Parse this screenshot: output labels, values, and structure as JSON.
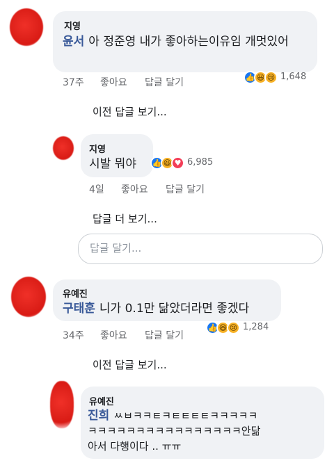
{
  "comments": [
    {
      "author": "지영",
      "tag": "윤서",
      "text": "아 정준영 내가 좋아하는이유임 개멋있어",
      "time": "37주",
      "like_label": "좋아요",
      "reply_label": "답글 달기",
      "reaction_count": "1,648",
      "reactions": [
        "like-icon",
        "haha-icon",
        "sad-icon"
      ]
    },
    {
      "author": "지영",
      "text": "시발 뭐야",
      "time": "4일",
      "like_label": "좋아요",
      "reply_label": "답글 달기",
      "reaction_count": "6,985",
      "reactions": [
        "like-icon",
        "haha-icon",
        "love-icon"
      ]
    },
    {
      "author": "유예진",
      "tag": "구태훈",
      "text": "니가 0.1만 닮았더라면 좋겠다",
      "time": "34주",
      "like_label": "좋아요",
      "reply_label": "답글 달기",
      "reaction_count": "1,284",
      "reactions": [
        "like-icon",
        "haha-icon",
        "sad-icon"
      ]
    },
    {
      "author": "유예진",
      "tag": "진희",
      "text_line1": "ㅆㅂㅋㅋㅌㅋㅌㅌㅌㅌㅋㅋㅋㅋㅋ",
      "text_line2": "ㅋㅋㅋㅋㅋㅋㅋㅋㅋㅋㅋㅋㅋㅋㅋㅋ안닮",
      "text_line3": "아서 다행이다 .. ㅠㅠ"
    }
  ],
  "view_previous_replies": "이전 답글 보기...",
  "view_more_replies": "답글 더 보기...",
  "reply_input": {
    "placeholder": "답글 달기..."
  },
  "colors": {
    "bubble": "#f0f2f5",
    "tag": "#385898",
    "meta": "#65676b",
    "like": "#1877f2"
  }
}
